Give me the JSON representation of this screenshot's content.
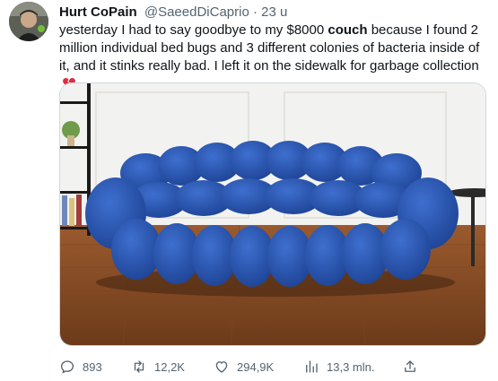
{
  "tweet": {
    "author_name": "Hurt CoPain",
    "author_handle": "@SaeedDiCaprio",
    "separator": "·",
    "time_ago": "23 u",
    "text_before": "yesterday I had to say goodbye to my $8000 ",
    "text_bold": "couch",
    "text_after": " because I found 2 million individual bed bugs and 3 different colonies of bacteria inside of it, and it stinks really bad. I left it on the sidewalk for garbage collection",
    "emoji": "broken-heart-icon",
    "media_subject": "blue-bubble-sofa"
  },
  "actions": {
    "replies": "893",
    "retweets": "12,2K",
    "likes": "294,9K",
    "views": "13,3 mln."
  },
  "colors": {
    "text": "#0f1419",
    "secondary": "#536471",
    "sofa": "#2452a8",
    "heart": "#e0245e"
  }
}
